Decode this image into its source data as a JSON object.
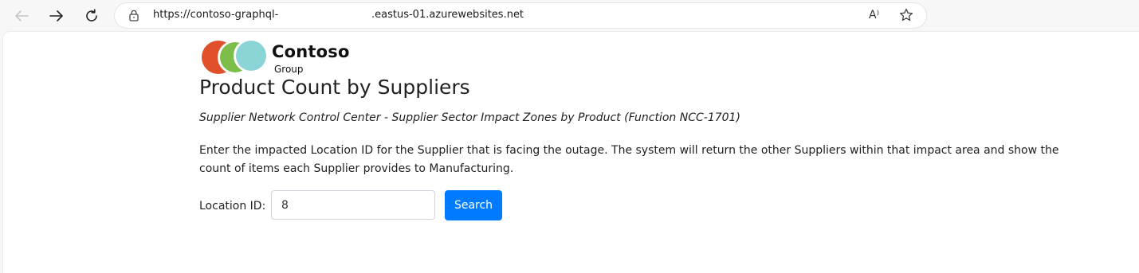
{
  "browser": {
    "url_part1": "https://contoso-graphql-",
    "url_part2": ".eastus-01.azurewebsites.net",
    "read_aloud_glyph": "A⁾"
  },
  "icons": {
    "back": "back-arrow-icon",
    "forward": "forward-arrow-icon",
    "refresh": "refresh-icon",
    "lock": "lock-icon",
    "read_aloud": "read-aloud-icon",
    "favorite": "star-icon"
  },
  "logo": {
    "word": "Contoso",
    "sub": "Group",
    "colors": [
      "#e0512b",
      "#7dbe4b",
      "#8ad4d6"
    ]
  },
  "page": {
    "title": "Product Count by Suppliers",
    "subtitle": "Supplier Network Control Center - Supplier Sector Impact Zones by Product (Function NCC-1701)",
    "description": "Enter the impacted Location ID for the Supplier that is facing the outage. The system will return the other Suppliers within that impact area and show the count of items each Supplier provides to Manufacturing."
  },
  "form": {
    "location_label": "Location ID:",
    "location_value": "8",
    "search_label": "Search"
  },
  "colors": {
    "primary_button": "#007bff"
  }
}
